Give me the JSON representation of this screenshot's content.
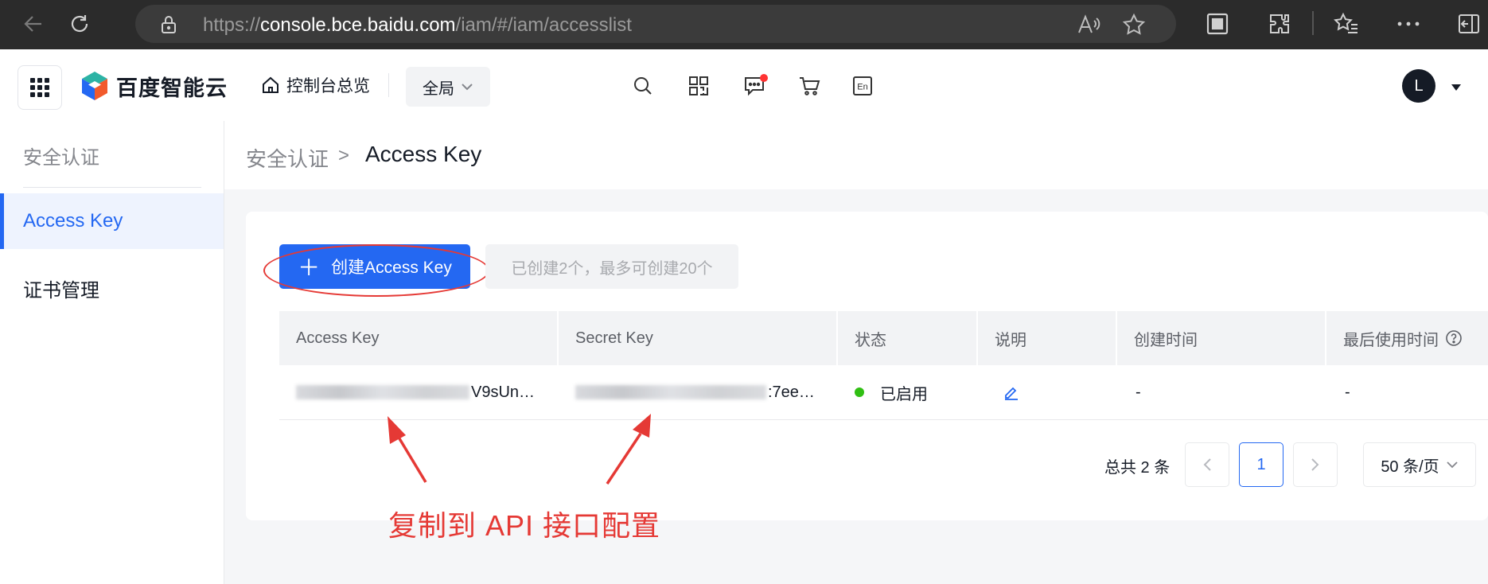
{
  "browser": {
    "url_scheme": "https://",
    "url_host": "console.bce.baidu.com",
    "url_path": "/iam/#/iam/accesslist"
  },
  "topnav": {
    "brand": "百度智能云",
    "overview_label": "控制台总览",
    "region_label": "全局",
    "avatar_initial": "L"
  },
  "sidebar": {
    "title": "安全认证",
    "items": [
      {
        "label": "Access Key",
        "active": true
      },
      {
        "label": "证书管理",
        "active": false
      }
    ]
  },
  "breadcrumb": {
    "parent": "安全认证",
    "separator": ">",
    "current": "Access Key"
  },
  "toolbar": {
    "create_plus": "＋",
    "create_label": "创建Access Key",
    "quota_hint": "已创建2个，最多可创建20个"
  },
  "table": {
    "columns": [
      "Access Key",
      "Secret Key",
      "状态",
      "说明",
      "创建时间",
      "最后使用时间"
    ],
    "rows": [
      {
        "access_key_visible_tail": "V9sUn…",
        "secret_key_visible_tail": ":7ee…",
        "status": "已启用",
        "created": "-",
        "last_used": "-"
      }
    ]
  },
  "pagination": {
    "total_text": "总共 2 条",
    "current_page": "1",
    "page_size": "50 条/页"
  },
  "annotation": {
    "text": "复制到 API 接口配置"
  },
  "colors": {
    "primary": "#2468f2",
    "status_enabled": "#30bf13",
    "annotation": "#e53935"
  }
}
